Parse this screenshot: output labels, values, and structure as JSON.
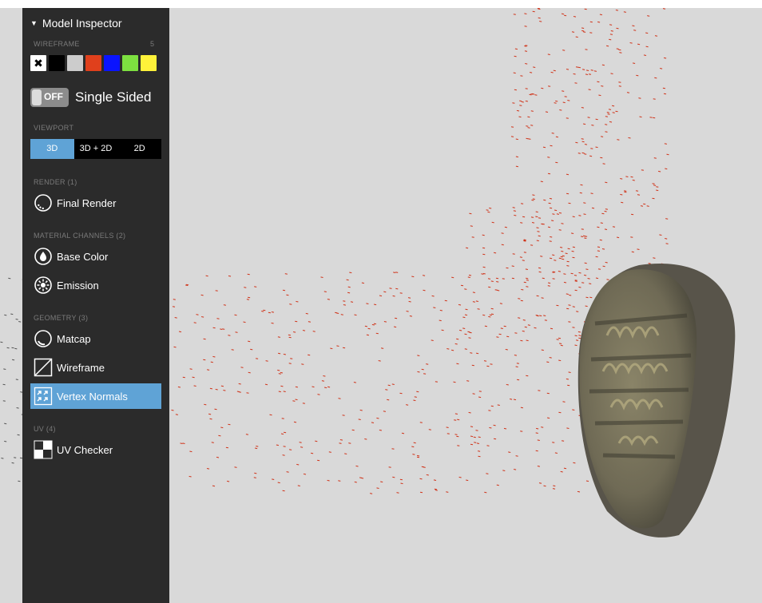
{
  "panel": {
    "title": "Model Inspector",
    "wireframe": {
      "label": "WIREFRAME",
      "count": "5",
      "swatches": [
        "none",
        "#000000",
        "#cccccc",
        "#e0401c",
        "#0a14ff",
        "#7de040",
        "#fff23a"
      ]
    },
    "single_sided": {
      "state": "OFF",
      "label": "Single Sided"
    },
    "viewport": {
      "label": "VIEWPORT",
      "options": [
        "3D",
        "3D + 2D",
        "2D"
      ],
      "selected": "3D"
    },
    "render": {
      "label": "RENDER (1)",
      "items": [
        {
          "label": "Final Render",
          "icon": "final-render-icon"
        }
      ]
    },
    "material_channels": {
      "label": "MATERIAL CHANNELS (2)",
      "items": [
        {
          "label": "Base Color",
          "icon": "base-color-icon"
        },
        {
          "label": "Emission",
          "icon": "emission-icon"
        }
      ]
    },
    "geometry": {
      "label": "GEOMETRY (3)",
      "items": [
        {
          "label": "Matcap",
          "icon": "matcap-icon"
        },
        {
          "label": "Wireframe",
          "icon": "wireframe-icon"
        },
        {
          "label": "Vertex Normals",
          "icon": "vertex-normals-icon",
          "active": true
        }
      ]
    },
    "uv": {
      "label": "UV (4)",
      "items": [
        {
          "label": "UV Checker",
          "icon": "uv-checker-icon"
        }
      ]
    }
  },
  "colors": {
    "panel_bg": "#2b2b2b",
    "accent": "#5fa3d6",
    "viewport_bg": "#d9d9d9",
    "normals": "#d0341a",
    "stone": "#6f6a55"
  }
}
